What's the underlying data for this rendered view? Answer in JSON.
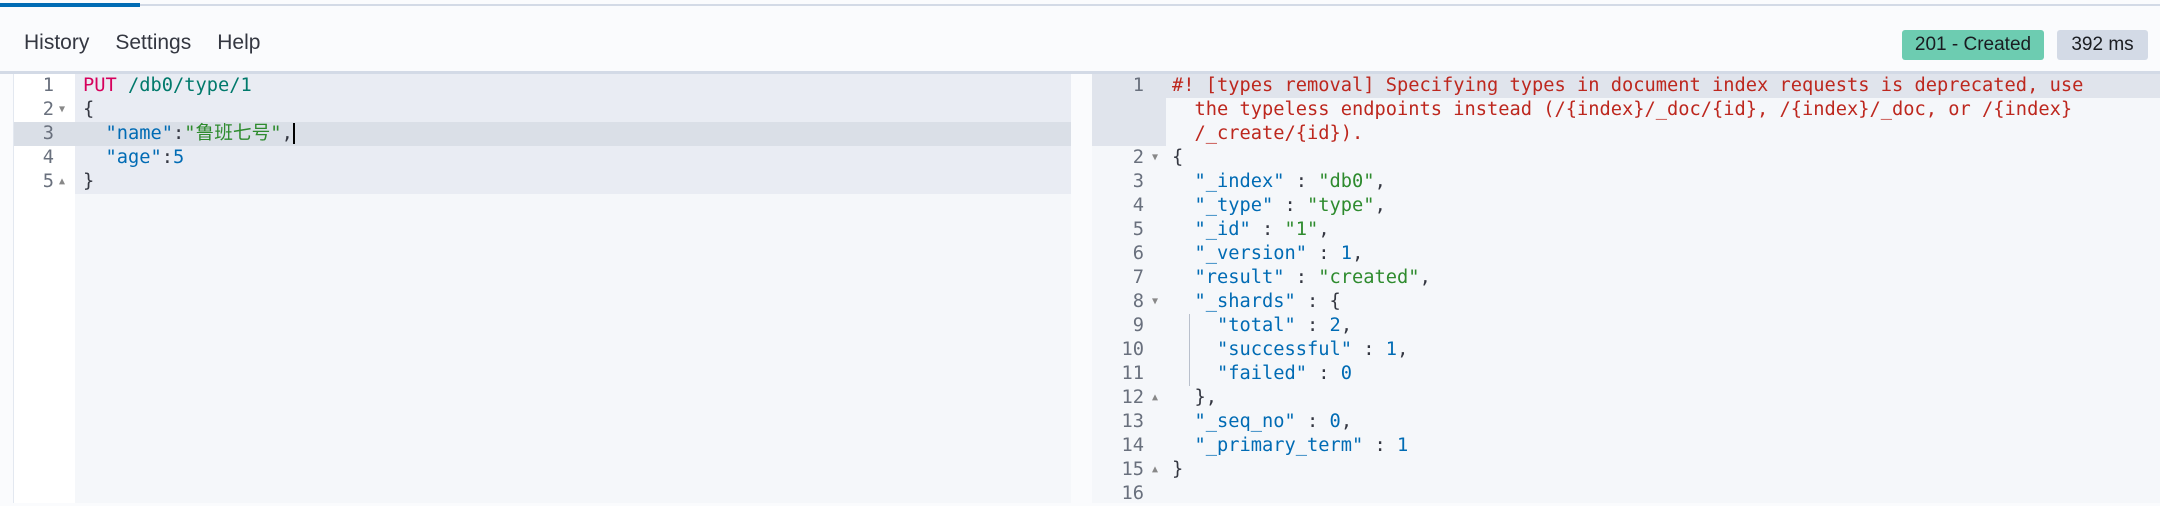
{
  "menu": {
    "items": [
      "History",
      "Settings",
      "Help"
    ]
  },
  "response_status": {
    "status": "201 - Created",
    "time": "392 ms",
    "status_color": "#6dccb1"
  },
  "request_editor": {
    "active_line": 3,
    "lines": [
      {
        "n": "1",
        "fold": "",
        "tokens": [
          [
            "method",
            "PUT"
          ],
          [
            "punc",
            " "
          ],
          [
            "url",
            "/db0/type/1"
          ]
        ]
      },
      {
        "n": "2",
        "fold": "down",
        "tokens": [
          [
            "punc",
            "{"
          ]
        ]
      },
      {
        "n": "3",
        "fold": "",
        "tokens": [
          [
            "punc",
            "  "
          ],
          [
            "key",
            "\"name\""
          ],
          [
            "punc",
            ":"
          ],
          [
            "str",
            "\"鲁班七号\""
          ],
          [
            "punc",
            ","
          ]
        ]
      },
      {
        "n": "4",
        "fold": "",
        "tokens": [
          [
            "punc",
            "  "
          ],
          [
            "key",
            "\"age\""
          ],
          [
            "punc",
            ":"
          ],
          [
            "num",
            "5"
          ]
        ]
      },
      {
        "n": "5",
        "fold": "up",
        "tokens": [
          [
            "punc",
            "}"
          ]
        ]
      }
    ],
    "icons": [
      "play-icon",
      "wrench-icon"
    ]
  },
  "response_editor": {
    "lines": [
      {
        "n": "1",
        "fold": "",
        "tokens": [
          [
            "warn",
            "#! [types removal] Specifying types in document index requests is deprecated, use"
          ]
        ]
      },
      {
        "n": "",
        "fold": "",
        "tokens": [
          [
            "warn",
            "  the typeless endpoints instead (/{index}/_doc/{id}, /{index}/_doc, or /{index}"
          ]
        ]
      },
      {
        "n": "",
        "fold": "",
        "tokens": [
          [
            "warn",
            "  /_create/{id})."
          ]
        ]
      },
      {
        "n": "2",
        "fold": "down",
        "tokens": [
          [
            "punc",
            "{"
          ]
        ]
      },
      {
        "n": "3",
        "fold": "",
        "tokens": [
          [
            "punc",
            "  "
          ],
          [
            "key",
            "\"_index\""
          ],
          [
            "punc",
            " : "
          ],
          [
            "str",
            "\"db0\""
          ],
          [
            "punc",
            ","
          ]
        ]
      },
      {
        "n": "4",
        "fold": "",
        "tokens": [
          [
            "punc",
            "  "
          ],
          [
            "key",
            "\"_type\""
          ],
          [
            "punc",
            " : "
          ],
          [
            "str",
            "\"type\""
          ],
          [
            "punc",
            ","
          ]
        ]
      },
      {
        "n": "5",
        "fold": "",
        "tokens": [
          [
            "punc",
            "  "
          ],
          [
            "key",
            "\"_id\""
          ],
          [
            "punc",
            " : "
          ],
          [
            "str",
            "\"1\""
          ],
          [
            "punc",
            ","
          ]
        ]
      },
      {
        "n": "6",
        "fold": "",
        "tokens": [
          [
            "punc",
            "  "
          ],
          [
            "key",
            "\"_version\""
          ],
          [
            "punc",
            " : "
          ],
          [
            "num",
            "1"
          ],
          [
            "punc",
            ","
          ]
        ]
      },
      {
        "n": "7",
        "fold": "",
        "tokens": [
          [
            "punc",
            "  "
          ],
          [
            "key",
            "\"result\""
          ],
          [
            "punc",
            " : "
          ],
          [
            "str",
            "\"created\""
          ],
          [
            "punc",
            ","
          ]
        ]
      },
      {
        "n": "8",
        "fold": "down",
        "tokens": [
          [
            "punc",
            "  "
          ],
          [
            "key",
            "\"_shards\""
          ],
          [
            "punc",
            " : {"
          ]
        ]
      },
      {
        "n": "9",
        "fold": "",
        "tokens": [
          [
            "punc",
            "    "
          ],
          [
            "key",
            "\"total\""
          ],
          [
            "punc",
            " : "
          ],
          [
            "num",
            "2"
          ],
          [
            "punc",
            ","
          ]
        ]
      },
      {
        "n": "10",
        "fold": "",
        "tokens": [
          [
            "punc",
            "    "
          ],
          [
            "key",
            "\"successful\""
          ],
          [
            "punc",
            " : "
          ],
          [
            "num",
            "1"
          ],
          [
            "punc",
            ","
          ]
        ]
      },
      {
        "n": "11",
        "fold": "",
        "tokens": [
          [
            "punc",
            "    "
          ],
          [
            "key",
            "\"failed\""
          ],
          [
            "punc",
            " : "
          ],
          [
            "num",
            "0"
          ]
        ]
      },
      {
        "n": "12",
        "fold": "up",
        "tokens": [
          [
            "punc",
            "  },"
          ]
        ]
      },
      {
        "n": "13",
        "fold": "",
        "tokens": [
          [
            "punc",
            "  "
          ],
          [
            "key",
            "\"_seq_no\""
          ],
          [
            "punc",
            " : "
          ],
          [
            "num",
            "0"
          ],
          [
            "punc",
            ","
          ]
        ]
      },
      {
        "n": "14",
        "fold": "",
        "tokens": [
          [
            "punc",
            "  "
          ],
          [
            "key",
            "\"_primary_term\""
          ],
          [
            "punc",
            " : "
          ],
          [
            "num",
            "1"
          ]
        ]
      },
      {
        "n": "15",
        "fold": "up",
        "tokens": [
          [
            "punc",
            "}"
          ]
        ]
      },
      {
        "n": "16",
        "fold": "",
        "tokens": []
      }
    ]
  }
}
